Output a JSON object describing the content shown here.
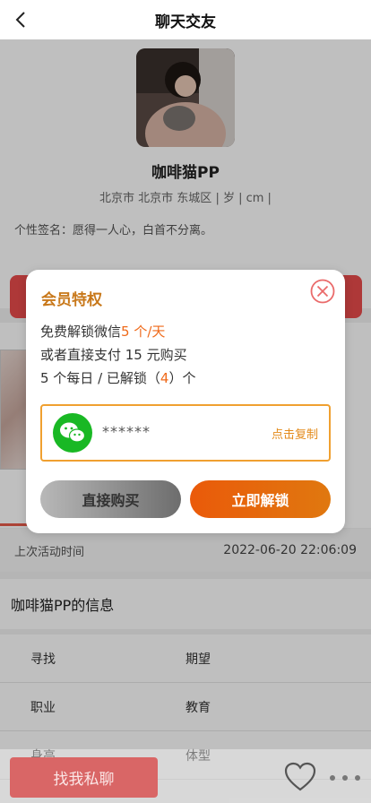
{
  "header": {
    "title": "聊天交友"
  },
  "profile": {
    "nickname": "咖啡猫PP",
    "location": "北京市 北京市 东城区 | 岁 | cm |",
    "signature": "个性签名：愿得一人心，白首不分离。"
  },
  "activity": {
    "label": "上次活动时间",
    "time": "2022-06-20 22:06:09"
  },
  "info": {
    "title": "咖啡猫PP的信息",
    "rows": [
      [
        "寻找",
        "期望"
      ],
      [
        "职业",
        "教育"
      ],
      [
        "身高",
        "体型"
      ]
    ]
  },
  "bottom": {
    "chat_label": "找我私聊"
  },
  "modal": {
    "title": "会员特权",
    "line1_prefix": "免费解锁微信",
    "line1_highlight": "5 个/天",
    "line2": "或者直接支付 15 元购买",
    "line3_prefix": "5 个每日 / 已解锁（",
    "line3_count": "4",
    "line3_suffix": "）个",
    "wechat_id": "******",
    "copy_label": "点击复制",
    "buy_label": "直接购买",
    "unlock_label": "立即解锁"
  },
  "colors": {
    "accent_orange": "#ef6a1a",
    "title_gold": "#c8781a",
    "wechat_green": "#19b824",
    "brand_red": "#e84b4b"
  },
  "icons": [
    "back-arrow-icon",
    "close-circle-icon",
    "wechat-icon",
    "heart-icon",
    "more-dots-icon"
  ]
}
